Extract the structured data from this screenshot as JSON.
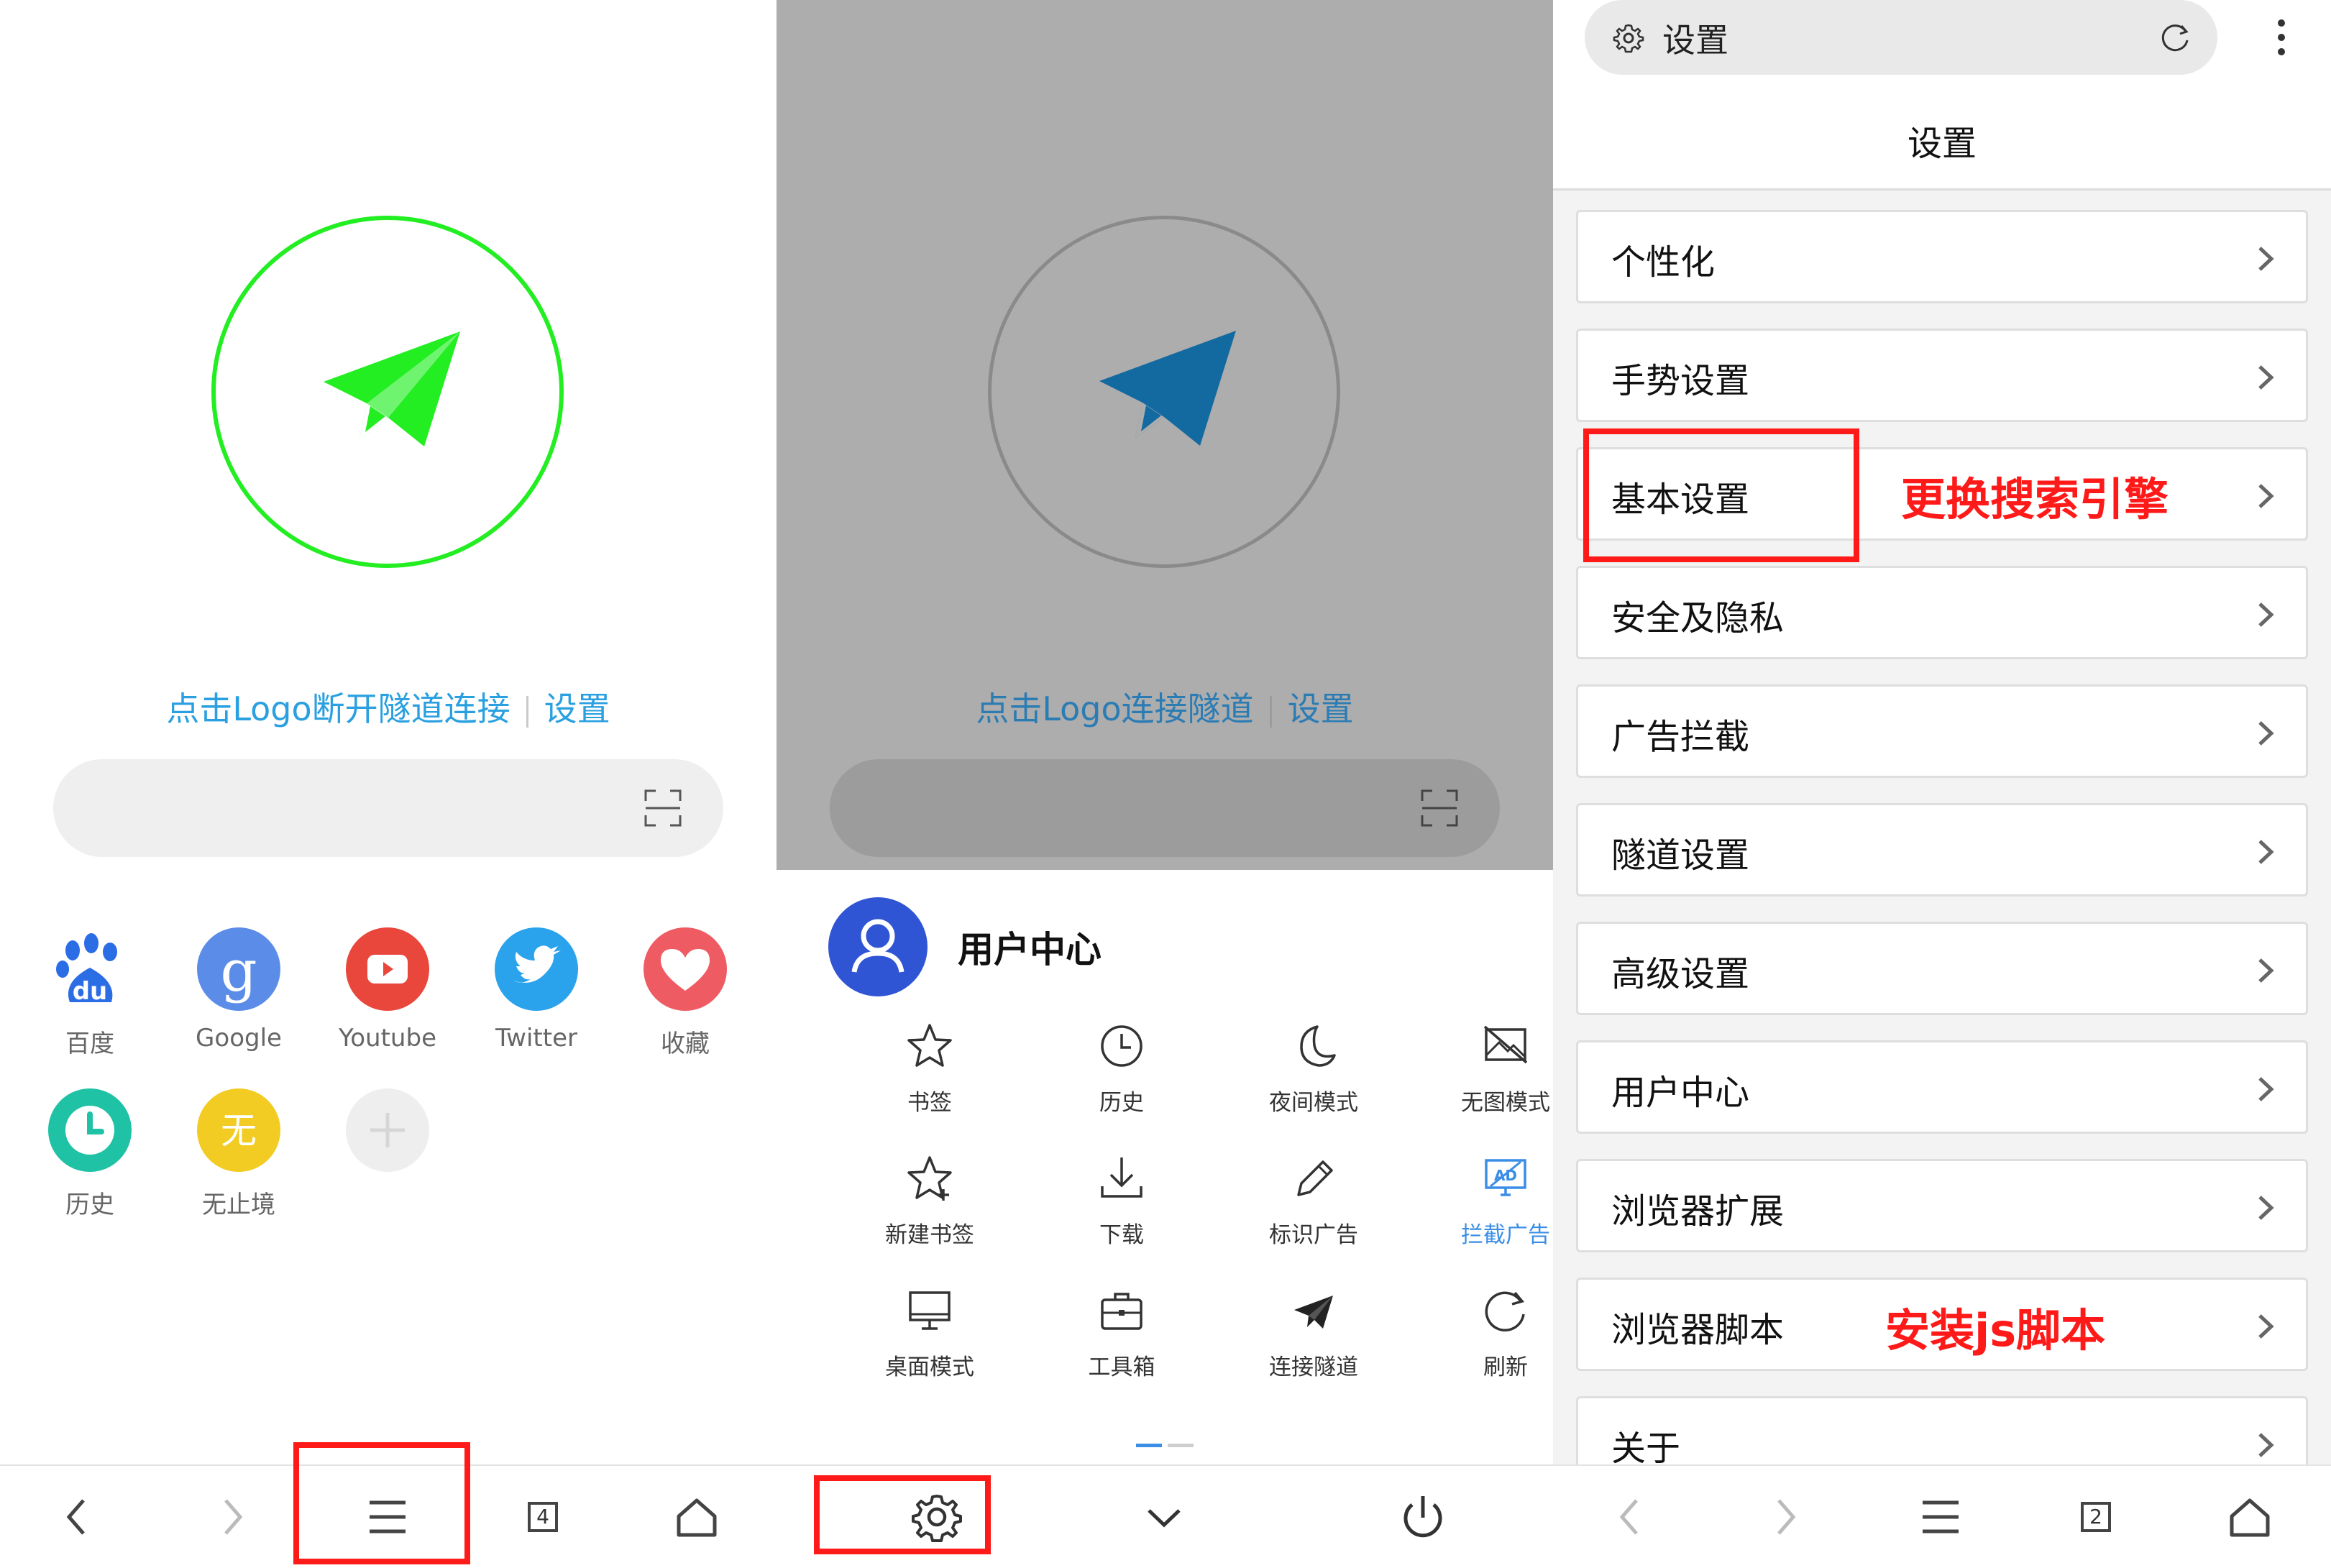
{
  "panel1": {
    "tunnel_text": "点击Logo断开隧道连接",
    "settings_link": "设置",
    "shortcuts": [
      {
        "label": "百度",
        "icon": "baidu-icon",
        "color": "#2b6de5"
      },
      {
        "label": "Google",
        "icon": "google-icon",
        "color": "#5b8de8"
      },
      {
        "label": "Youtube",
        "icon": "youtube-icon",
        "color": "#e9463c"
      },
      {
        "label": "Twitter",
        "icon": "twitter-icon",
        "color": "#2aa2ec"
      },
      {
        "label": "收藏",
        "icon": "favorites-icon",
        "color": "#ef5b63"
      },
      {
        "label": "历史",
        "icon": "history-icon",
        "color": "#20c2a6"
      },
      {
        "label": "无止境",
        "icon": "wuzhijing-icon",
        "color": "#f2cc22",
        "glyph": "无"
      },
      {
        "label": "",
        "icon": "add-shortcut-icon",
        "color": "#eeeeee"
      }
    ],
    "tab_count": "4"
  },
  "panel2": {
    "tunnel_text": "点击Logo连接隧道",
    "settings_link": "设置",
    "user_center": "用户中心",
    "menu": [
      {
        "label": "书签",
        "icon": "star-icon"
      },
      {
        "label": "历史",
        "icon": "clock-icon"
      },
      {
        "label": "夜间模式",
        "icon": "moon-icon"
      },
      {
        "label": "无图模式",
        "icon": "no-image-icon"
      },
      {
        "label": "新建书签",
        "icon": "star-plus-icon"
      },
      {
        "label": "下载",
        "icon": "download-icon"
      },
      {
        "label": "标识广告",
        "icon": "pencil-icon"
      },
      {
        "label": "拦截广告",
        "icon": "ad-block-icon",
        "active": true
      },
      {
        "label": "桌面模式",
        "icon": "desktop-icon"
      },
      {
        "label": "工具箱",
        "icon": "toolbox-icon"
      },
      {
        "label": "连接隧道",
        "icon": "plane-icon"
      },
      {
        "label": "刷新",
        "icon": "refresh-icon"
      }
    ]
  },
  "panel3": {
    "url_text": "设置",
    "page_title": "设置",
    "rows": [
      "个性化",
      "手势设置",
      "基本设置",
      "安全及隐私",
      "广告拦截",
      "隧道设置",
      "高级设置",
      "用户中心",
      "浏览器扩展",
      "浏览器脚本",
      "关于"
    ],
    "annotations": {
      "search_engine": "更换搜索引擎",
      "install_script": "安装js脚本"
    },
    "tab_count": "2"
  },
  "colors": {
    "accent_green": "#22ee22",
    "link_blue": "#2aa0e0",
    "highlight_red": "#ff1a1a",
    "active_blue": "#3a8ee6",
    "avatar_blue": "#2f55d4"
  }
}
